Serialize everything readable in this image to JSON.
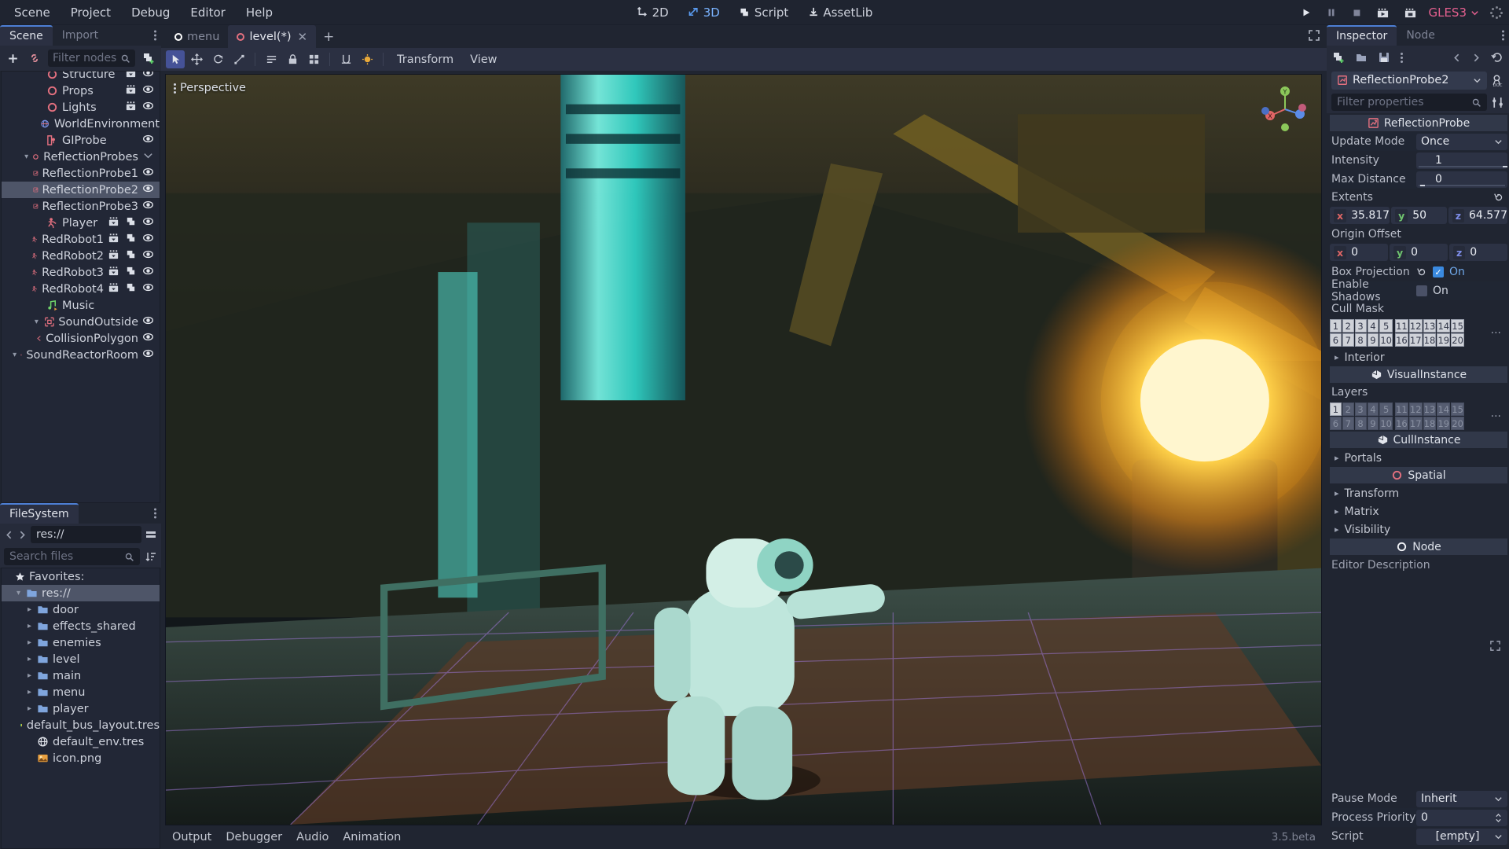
{
  "menubar": {
    "items": [
      "Scene",
      "Project",
      "Debug",
      "Editor",
      "Help"
    ],
    "modes": [
      {
        "label": "2D",
        "icon": "two-d-icon",
        "active": false
      },
      {
        "label": "3D",
        "icon": "three-d-icon",
        "active": true
      },
      {
        "label": "Script",
        "icon": "script-icon",
        "active": false
      },
      {
        "label": "AssetLib",
        "icon": "assetlib-download-icon",
        "active": false
      }
    ],
    "play_controls": [
      "play-icon",
      "pause-icon",
      "stop-icon",
      "play-scene-icon",
      "play-custom-scene-icon"
    ],
    "renderer": "GLES3"
  },
  "left_panel": {
    "tabs": [
      {
        "label": "Scene",
        "active": true
      },
      {
        "label": "Import",
        "active": false
      }
    ],
    "toolbar": {
      "add_node": "add-node-icon",
      "instance": "link-instance-icon",
      "filter_placeholder": "Filter nodes",
      "search_icon": "search-icon",
      "create_script": "attach-script-icon"
    },
    "tree": [
      {
        "label": "Structure",
        "icon": "spatial-icon",
        "depth": 2,
        "arrow": "",
        "trailing": [
          "group-icon",
          "visibility-icon"
        ],
        "clipped": true
      },
      {
        "label": "Props",
        "icon": "spatial-icon",
        "depth": 2,
        "arrow": "",
        "trailing": [
          "group-icon",
          "visibility-icon"
        ]
      },
      {
        "label": "Lights",
        "icon": "spatial-icon",
        "depth": 2,
        "arrow": "",
        "trailing": [
          "group-icon",
          "visibility-icon"
        ]
      },
      {
        "label": "WorldEnvironment",
        "icon": "world-environment-icon",
        "depth": 2,
        "arrow": "",
        "trailing": []
      },
      {
        "label": "GIProbe",
        "icon": "giprobe-icon",
        "depth": 2,
        "arrow": "",
        "trailing": [
          "visibility-icon"
        ]
      },
      {
        "label": "ReflectionProbes",
        "icon": "spatial-icon",
        "depth": 2,
        "arrow": "v",
        "trailing": [
          "collapse-icon"
        ]
      },
      {
        "label": "ReflectionProbe1",
        "icon": "reflection-probe-icon",
        "depth": 3,
        "arrow": "",
        "trailing": [
          "visibility-icon"
        ]
      },
      {
        "label": "ReflectionProbe2",
        "icon": "reflection-probe-icon",
        "depth": 3,
        "arrow": "",
        "trailing": [
          "visibility-icon"
        ],
        "selected": true
      },
      {
        "label": "ReflectionProbe3",
        "icon": "reflection-probe-icon",
        "depth": 3,
        "arrow": "",
        "trailing": [
          "visibility-icon"
        ]
      },
      {
        "label": "Player",
        "icon": "kinematic-body-icon",
        "depth": 2,
        "arrow": "",
        "trailing": [
          "group-icon",
          "script-icon",
          "visibility-icon"
        ]
      },
      {
        "label": "RedRobot1",
        "icon": "kinematic-body-icon",
        "depth": 2,
        "arrow": "",
        "trailing": [
          "group-icon",
          "script-icon",
          "visibility-icon"
        ]
      },
      {
        "label": "RedRobot2",
        "icon": "kinematic-body-icon",
        "depth": 2,
        "arrow": "",
        "trailing": [
          "group-icon",
          "script-icon",
          "visibility-icon"
        ]
      },
      {
        "label": "RedRobot3",
        "icon": "kinematic-body-icon",
        "depth": 2,
        "arrow": "",
        "trailing": [
          "group-icon",
          "script-icon",
          "visibility-icon"
        ]
      },
      {
        "label": "RedRobot4",
        "icon": "kinematic-body-icon",
        "depth": 2,
        "arrow": "",
        "trailing": [
          "group-icon",
          "script-icon",
          "visibility-icon"
        ]
      },
      {
        "label": "Music",
        "icon": "audio-stream-icon",
        "depth": 2,
        "arrow": "",
        "trailing": []
      },
      {
        "label": "SoundOutside",
        "icon": "area-icon",
        "depth": 2,
        "arrow": "v",
        "trailing": [
          "visibility-icon"
        ]
      },
      {
        "label": "CollisionPolygon",
        "icon": "collision-polygon-icon",
        "depth": 3,
        "arrow": "",
        "trailing": [
          "visibility-icon"
        ]
      },
      {
        "label": "SoundReactorRoom",
        "icon": "area-icon",
        "depth": 2,
        "arrow": "v",
        "trailing": [
          "visibility-icon"
        ]
      }
    ]
  },
  "filesystem": {
    "tab": "FileSystem",
    "path": "res://",
    "nav_back": "chevron-left-icon",
    "nav_forward": "chevron-right-icon",
    "split_mode_icon": "split-mode-icon",
    "search_placeholder": "Search files",
    "sort_icon": "sort-icon",
    "favorites_label": "Favorites:",
    "items": [
      {
        "label": "res://",
        "type": "folder",
        "depth": 0,
        "arrow": "v",
        "selected": true
      },
      {
        "label": "door",
        "type": "folder",
        "depth": 1,
        "arrow": ">"
      },
      {
        "label": "effects_shared",
        "type": "folder",
        "depth": 1,
        "arrow": ">"
      },
      {
        "label": "enemies",
        "type": "folder",
        "depth": 1,
        "arrow": ">"
      },
      {
        "label": "level",
        "type": "folder",
        "depth": 1,
        "arrow": ">"
      },
      {
        "label": "main",
        "type": "folder",
        "depth": 1,
        "arrow": ">"
      },
      {
        "label": "menu",
        "type": "folder",
        "depth": 1,
        "arrow": ">"
      },
      {
        "label": "player",
        "type": "folder",
        "depth": 1,
        "arrow": ">"
      },
      {
        "label": "default_bus_layout.tres",
        "type": "audio-bus-file",
        "depth": 1,
        "arrow": ""
      },
      {
        "label": "default_env.tres",
        "type": "environment-file",
        "depth": 1,
        "arrow": ""
      },
      {
        "label": "icon.png",
        "type": "image-file",
        "depth": 1,
        "arrow": ""
      }
    ]
  },
  "scene_tabs": {
    "tabs": [
      {
        "label": "menu",
        "active": false,
        "closable": false
      },
      {
        "label": "level(*)",
        "active": true,
        "closable": true
      }
    ],
    "add_tab": "+",
    "distraction_free_icon": "distraction-free-icon"
  },
  "viewport": {
    "toolbar": {
      "tools": [
        "select-mode-icon",
        "move-mode-icon",
        "rotate-mode-icon",
        "scale-mode-icon",
        "list-select-icon",
        "lock-icon",
        "group-icon",
        "snap-icon",
        "light-icon"
      ],
      "menus": [
        "Transform",
        "View"
      ]
    },
    "perspective_label": "Perspective",
    "gizmo_axes": [
      "X",
      "Y",
      "Z"
    ]
  },
  "bottom_panel": {
    "items": [
      "Output",
      "Debugger",
      "Audio",
      "Animation"
    ],
    "version": "3.5.beta"
  },
  "inspector": {
    "tabs": [
      {
        "label": "Inspector",
        "active": true
      },
      {
        "label": "Node",
        "active": false
      }
    ],
    "toolbar": {
      "new_resource": "new-resource-icon",
      "load": "folder-open-icon",
      "save": "save-icon",
      "tools": "kebab-icon",
      "back": "chevron-left-icon",
      "forward": "chevron-right-icon",
      "history": "history-icon"
    },
    "selected_node": "ReflectionProbe2",
    "selected_node_icon": "reflection-probe-icon",
    "open_docs_icon": "open-docs-icon",
    "object_menu_icon": "object-tools-icon",
    "filter_placeholder": "Filter properties",
    "sections": [
      {
        "type": "category",
        "title": "ReflectionProbe",
        "icon": "reflection-probe-icon"
      },
      {
        "type": "enum",
        "name": "Update Mode",
        "value": "Once"
      },
      {
        "type": "number",
        "name": "Intensity",
        "value": "1",
        "fill": 97
      },
      {
        "type": "number",
        "name": "Max Distance",
        "value": "0",
        "fill": 2
      },
      {
        "type": "vector_label",
        "name": "Extents",
        "revert": true
      },
      {
        "type": "vector",
        "values": [
          {
            "axis": "x",
            "value": "35.817"
          },
          {
            "axis": "y",
            "value": "50"
          },
          {
            "axis": "z",
            "value": "64.577"
          }
        ]
      },
      {
        "type": "vector_label",
        "name": "Origin Offset",
        "revert": false
      },
      {
        "type": "vector",
        "values": [
          {
            "axis": "x",
            "value": "0"
          },
          {
            "axis": "y",
            "value": "0"
          },
          {
            "axis": "z",
            "value": "0"
          }
        ]
      },
      {
        "type": "bool",
        "name": "Box Projection",
        "value_label": "On",
        "checked": true,
        "revert": true
      },
      {
        "type": "bool",
        "name": "Enable Shadows",
        "value_label": "On",
        "checked": false,
        "revert": false
      },
      {
        "type": "flags",
        "name": "Cull Mask",
        "cells": [
          "1",
          "2",
          "3",
          "4",
          "5",
          "11",
          "12",
          "13",
          "14",
          "15",
          "6",
          "7",
          "8",
          "9",
          "10",
          "16",
          "17",
          "18",
          "19",
          "20"
        ],
        "all_on": true
      },
      {
        "type": "subsection",
        "name": "Interior"
      },
      {
        "type": "category",
        "title": "VisualInstance",
        "icon": "visual-instance-icon"
      },
      {
        "type": "flags",
        "name": "Layers",
        "cells": [
          "1",
          "2",
          "3",
          "4",
          "5",
          "11",
          "12",
          "13",
          "14",
          "15",
          "6",
          "7",
          "8",
          "9",
          "10",
          "16",
          "17",
          "18",
          "19",
          "20"
        ],
        "on_indices": [
          0
        ]
      },
      {
        "type": "category",
        "title": "CullInstance",
        "icon": "visual-instance-icon"
      },
      {
        "type": "subsection",
        "name": "Portals"
      },
      {
        "type": "category",
        "title": "Spatial",
        "icon": "spatial-icon"
      },
      {
        "type": "subsection",
        "name": "Transform"
      },
      {
        "type": "subsection",
        "name": "Matrix"
      },
      {
        "type": "subsection",
        "name": "Visibility"
      },
      {
        "type": "category",
        "title": "Node",
        "icon": "node-icon"
      },
      {
        "type": "label",
        "name": "Editor Description"
      }
    ],
    "footer": [
      {
        "name": "Pause Mode",
        "value": "Inherit",
        "kind": "enum"
      },
      {
        "name": "Process Priority",
        "value": "0",
        "kind": "spin"
      },
      {
        "name": "Script",
        "value": "[empty]",
        "kind": "resource"
      }
    ]
  }
}
